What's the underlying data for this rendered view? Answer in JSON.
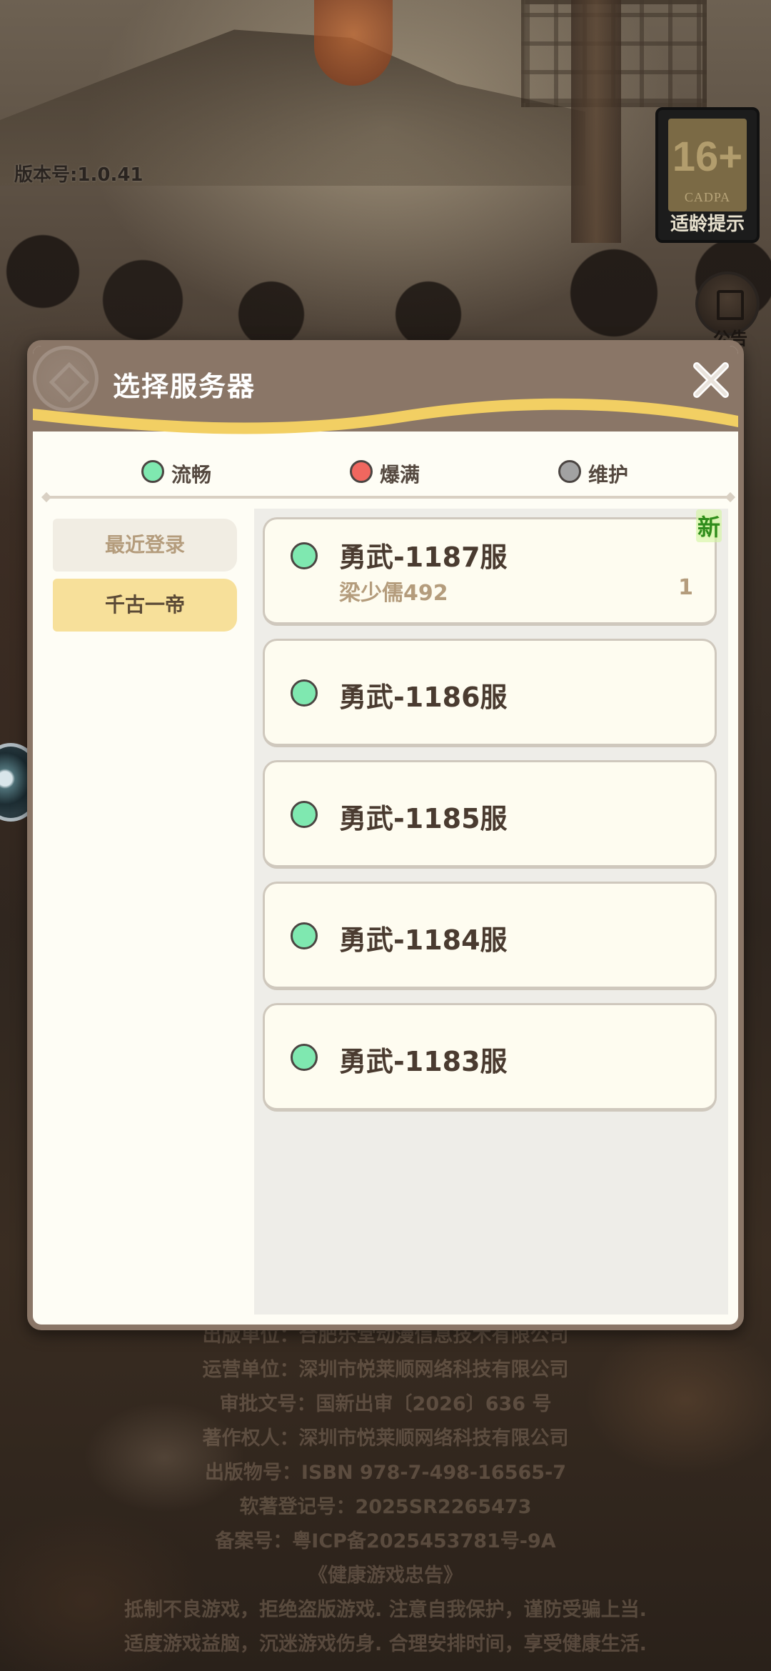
{
  "version": "版本号:1.0.41",
  "age_badge": {
    "age": "16+",
    "org": "CADPA",
    "tip": "适龄提示"
  },
  "notice": {
    "label": "公告",
    "icon": "notice-icon"
  },
  "modal": {
    "title": "选择服务器",
    "close_icon": "close-icon",
    "legend": [
      {
        "label": "流畅",
        "color": "#7fe8b0"
      },
      {
        "label": "爆满",
        "color": "#f0675f"
      },
      {
        "label": "维护",
        "color": "#a2a2a2"
      }
    ],
    "tabs": [
      {
        "label": "最近登录",
        "selected": false
      },
      {
        "label": "千古一帝",
        "selected": true
      }
    ],
    "servers": [
      {
        "name": "勇武-1187服",
        "status": "流畅",
        "is_new": true,
        "new_label": "新",
        "character": "梁少儒492",
        "level": "1"
      },
      {
        "name": "勇武-1186服",
        "status": "流畅",
        "is_new": false
      },
      {
        "name": "勇武-1185服",
        "status": "流畅",
        "is_new": false
      },
      {
        "name": "勇武-1184服",
        "status": "流畅",
        "is_new": false
      },
      {
        "name": "勇武-1183服",
        "status": "流畅",
        "is_new": false
      }
    ]
  },
  "legal": [
    "出版单位：合肥乐堂动漫信息技术有限公司",
    "运营单位：深圳市悦莱顺网络科技有限公司",
    "审批文号：国新出审〔2026〕636 号",
    "著作权人：深圳市悦莱顺网络科技有限公司",
    "出版物号：ISBN 978-7-498-16565-7",
    "软著登记号：2025SR2265473",
    "备案号：粤ICP备2025453781号-9A",
    "《健康游戏忠告》",
    "抵制不良游戏，拒绝盗版游戏. 注意自我保护，谨防受骗上当.",
    "适度游戏益脑，沉迷游戏伤身. 合理安排时间，享受健康生活."
  ]
}
